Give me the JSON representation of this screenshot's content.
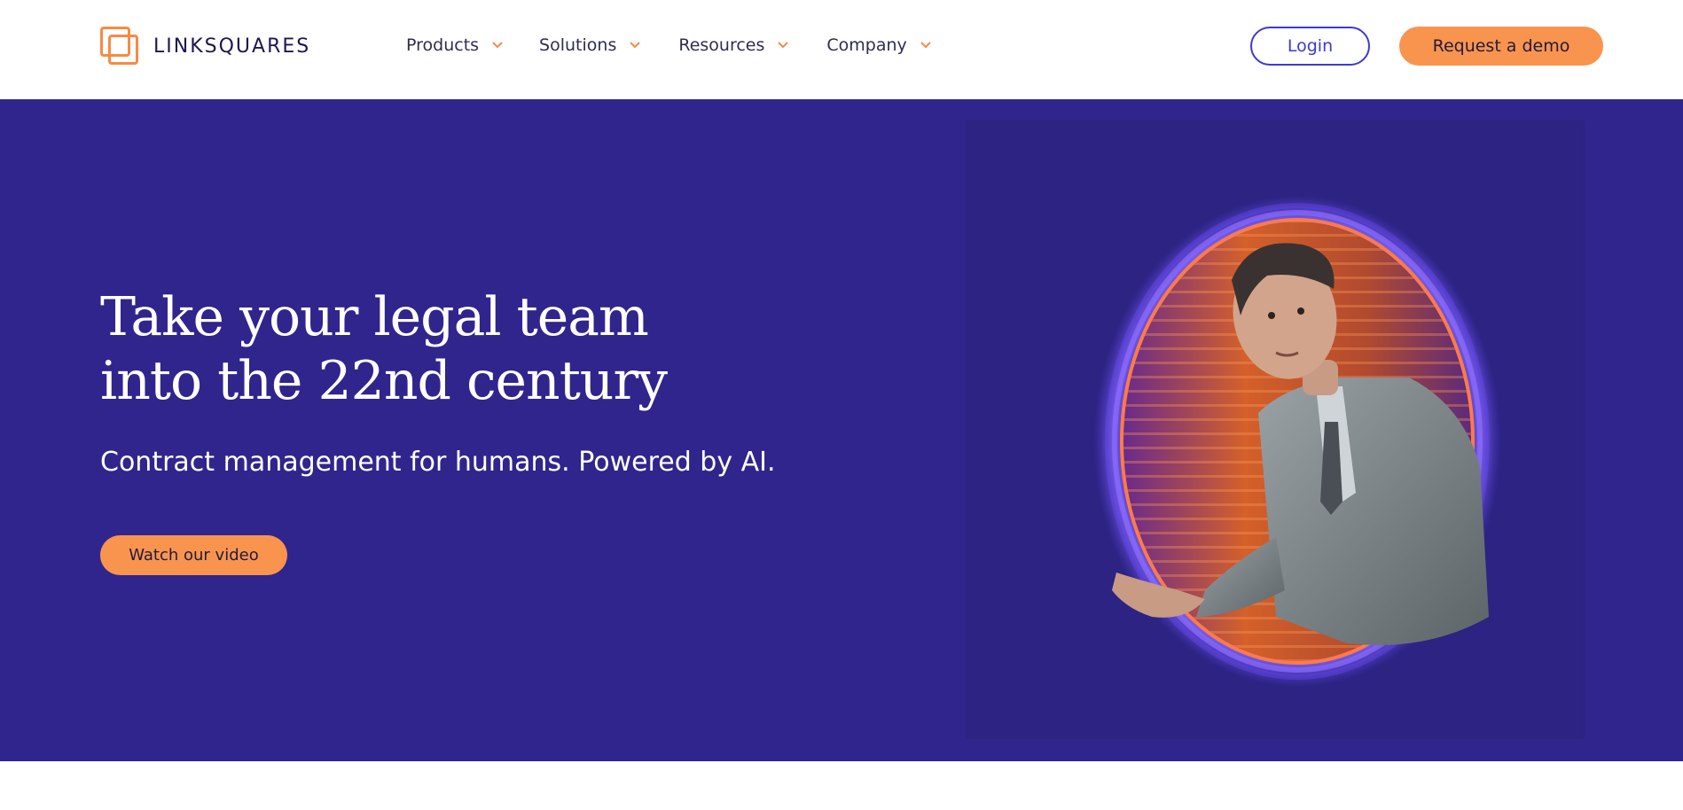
{
  "header": {
    "logo_text": "LINKSQUARES",
    "nav": [
      {
        "label": "Products"
      },
      {
        "label": "Solutions"
      },
      {
        "label": "Resources"
      },
      {
        "label": "Company"
      }
    ],
    "login_label": "Login",
    "demo_label": "Request a demo"
  },
  "hero": {
    "headline_line1": "Take your legal team",
    "headline_line2": "into the 22nd century",
    "subhead": "Contract management for humans. Powered by AI.",
    "video_button_label": "Watch our video"
  },
  "colors": {
    "brand_orange": "#f9944f",
    "hero_purple": "#30258c",
    "login_blue": "#3b3ad4",
    "portal_glow": "#7a5cff"
  },
  "icons": {
    "logo": "linksquares-logo-icon",
    "nav_chevron": "chevron-down-icon"
  }
}
